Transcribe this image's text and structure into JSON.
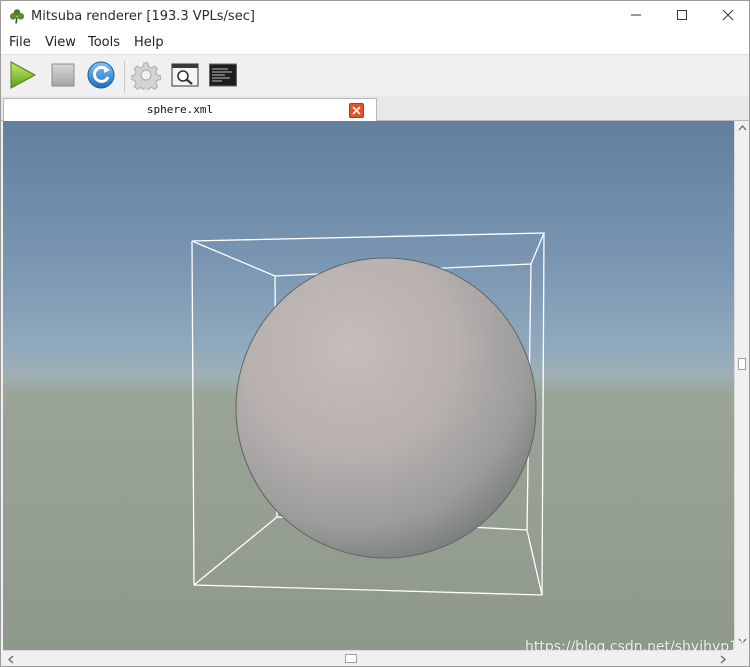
{
  "window": {
    "title": "Mitsuba renderer [193.3 VPLs/sec]",
    "controls": {
      "minimize": "minimize-icon",
      "maximize": "maximize-icon",
      "close": "close-icon"
    }
  },
  "menu": {
    "items": [
      {
        "label": "File"
      },
      {
        "label": "View"
      },
      {
        "label": "Tools"
      },
      {
        "label": "Help"
      }
    ]
  },
  "toolbar": {
    "buttons": [
      {
        "icon": "play-icon"
      },
      {
        "icon": "stop-icon"
      },
      {
        "icon": "refresh-icon"
      },
      {
        "icon": "gear-icon"
      },
      {
        "icon": "preview-window-icon"
      },
      {
        "icon": "console-icon"
      }
    ]
  },
  "tabs": [
    {
      "label": "sphere.xml",
      "active": true
    }
  ],
  "viewport": {
    "colors": {
      "sky_top": "#627f9e",
      "horizon": "#9eafb5",
      "ground": "#96a093",
      "sphere": "#b9b3b3",
      "bbox_lines": "#ffffff"
    }
  },
  "watermark": "https://blog.csdn.net/shyjhyp11"
}
